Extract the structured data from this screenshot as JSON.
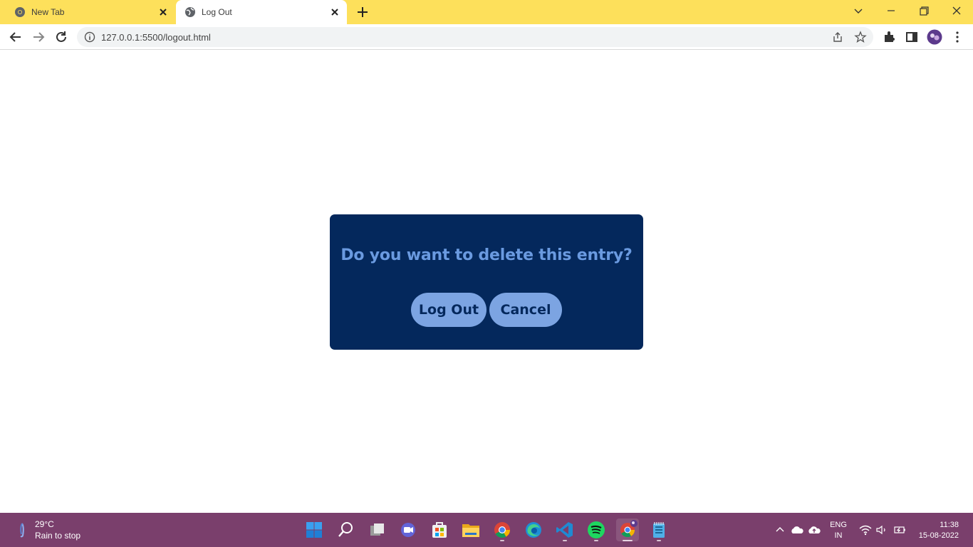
{
  "browser": {
    "tabs": [
      {
        "title": "New Tab",
        "icon": "chrome-icon"
      },
      {
        "title": "Log Out",
        "icon": "globe-icon"
      }
    ],
    "address": "127.0.0.1:5500/logout.html"
  },
  "dialog": {
    "question": "Do you want to delete this entry?",
    "confirm_label": "Log Out",
    "cancel_label": "Cancel"
  },
  "taskbar": {
    "weather": {
      "temperature": "29°C",
      "description": "Rain to stop"
    },
    "language": {
      "line1": "ENG",
      "line2": "IN"
    },
    "time": "11:38",
    "date": "15-08-2022"
  },
  "colors": {
    "tabstrip": "#fde05b",
    "dialog_bg": "#04285c",
    "dialog_text": "#6a9ae0",
    "button_bg": "#7ca4e2",
    "taskbar": "#7a3f6c"
  }
}
